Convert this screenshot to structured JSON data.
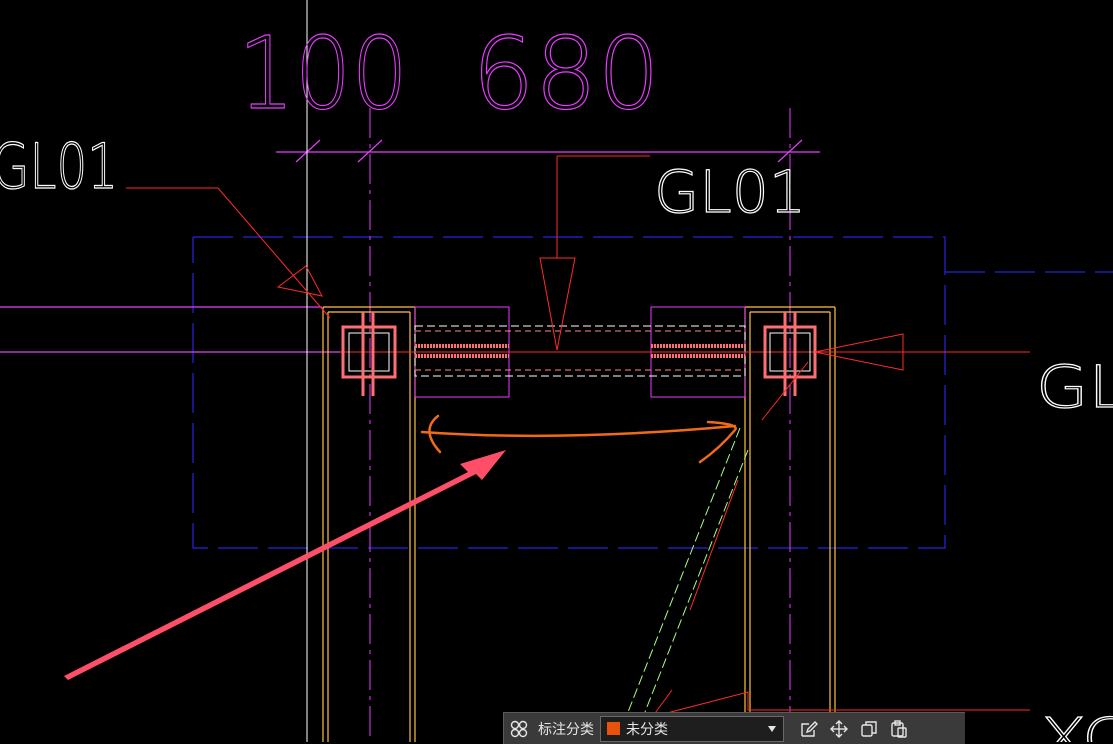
{
  "drawing": {
    "dim_label_1": "100",
    "dim_label_2": "680",
    "beam_tag_left": "GL01",
    "beam_tag_center": "GL01",
    "beam_tag_right": "GL",
    "corner_text": "XC"
  },
  "toolbar": {
    "category_label": "标注分类",
    "category_value": "未分类",
    "category_color": "#e8520c",
    "icons": [
      "grid-icon",
      "chevron-down-icon",
      "edit-icon",
      "move-icon",
      "copy-icon",
      "paste-icon"
    ]
  },
  "colors": {
    "magenta": "#e83cff",
    "red": "#ff2a2a",
    "blue": "#2525e0",
    "yellow": "#ffc23d",
    "green": "#a8ff84",
    "highlight_orange": "#f06a18",
    "arrow_pink": "#ff4f68"
  }
}
